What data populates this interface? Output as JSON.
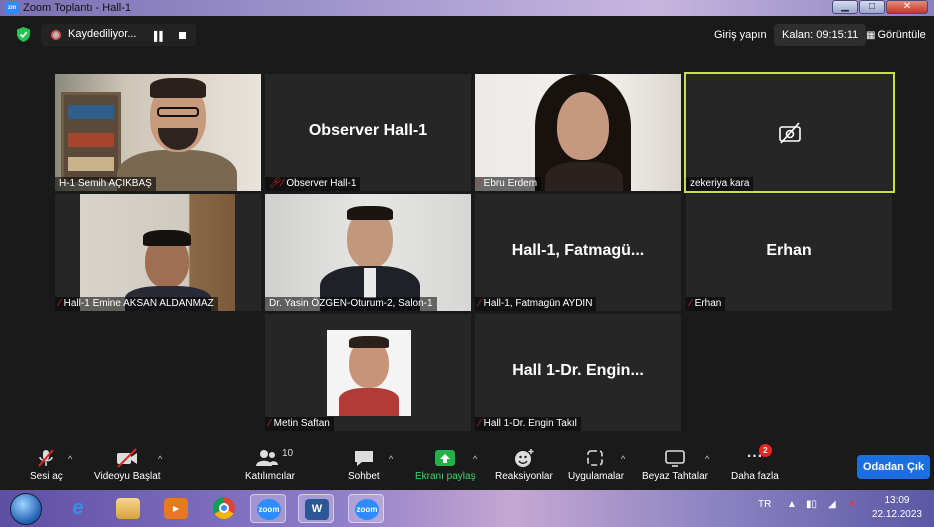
{
  "window": {
    "title": "Zoom Toplantı - Hall-1",
    "app_icon": "zoom"
  },
  "topbar": {
    "recording_label": "Kaydediliyor...",
    "sign_in": "Giriş yapın",
    "timer": "Kalan: 09:15:11",
    "view": "Görüntüle"
  },
  "participants": [
    {
      "name": "H-1 Semih AÇIKBAŞ",
      "video": true,
      "muted": false
    },
    {
      "name": "Observer Hall-1",
      "display": "Observer Hall-1",
      "video": false,
      "muted": true
    },
    {
      "name": "Ebru Erdem",
      "video": true,
      "muted": true
    },
    {
      "name": "zekeriya kara",
      "video": false,
      "camera_off": true,
      "active_speaker": true
    },
    {
      "name": "Hall-1 Emine AKSAN ALDANMAZ",
      "video": true,
      "muted": true
    },
    {
      "name": "Dr. Yasin ÖZGEN-Oturum-2, Salon-1",
      "video": true,
      "muted": false
    },
    {
      "name": "Hall-1, Fatmagün AYDIN",
      "display": "Hall-1,  Fatmagü...",
      "video": false,
      "muted": true
    },
    {
      "name": "Erhan",
      "display": "Erhan",
      "video": false,
      "muted": true
    },
    {
      "name": "Metin Saftan",
      "video": true,
      "muted": true
    },
    {
      "name": "Hall 1-Dr. Engin Takıl",
      "display": "Hall 1-Dr. Engin...",
      "video": false,
      "muted": true
    }
  ],
  "toolbar": {
    "audio": "Sesi aç",
    "video": "Videoyu Başlat",
    "participants": "Katılımcılar",
    "participants_count": "10",
    "chat": "Sohbet",
    "share": "Ekranı paylaş",
    "reactions": "Reaksiyonlar",
    "apps": "Uygulamalar",
    "whiteboard": "Beyaz Tahtalar",
    "more": "Daha fazla",
    "more_badge": "2",
    "leave": "Odadan Çık"
  },
  "taskbar": {
    "apps": [
      "start",
      "internet-explorer",
      "file-explorer",
      "media-player",
      "chrome",
      "zoom",
      "word",
      "zoom"
    ],
    "zoom_label": "zoom",
    "language": "TR",
    "time": "13:09",
    "date": "22.12.2023"
  },
  "colors": {
    "active_border": "#c7e04a",
    "share_green": "#33cc55",
    "leave_blue": "#1c6fe0",
    "muted_red": "#e02424"
  }
}
